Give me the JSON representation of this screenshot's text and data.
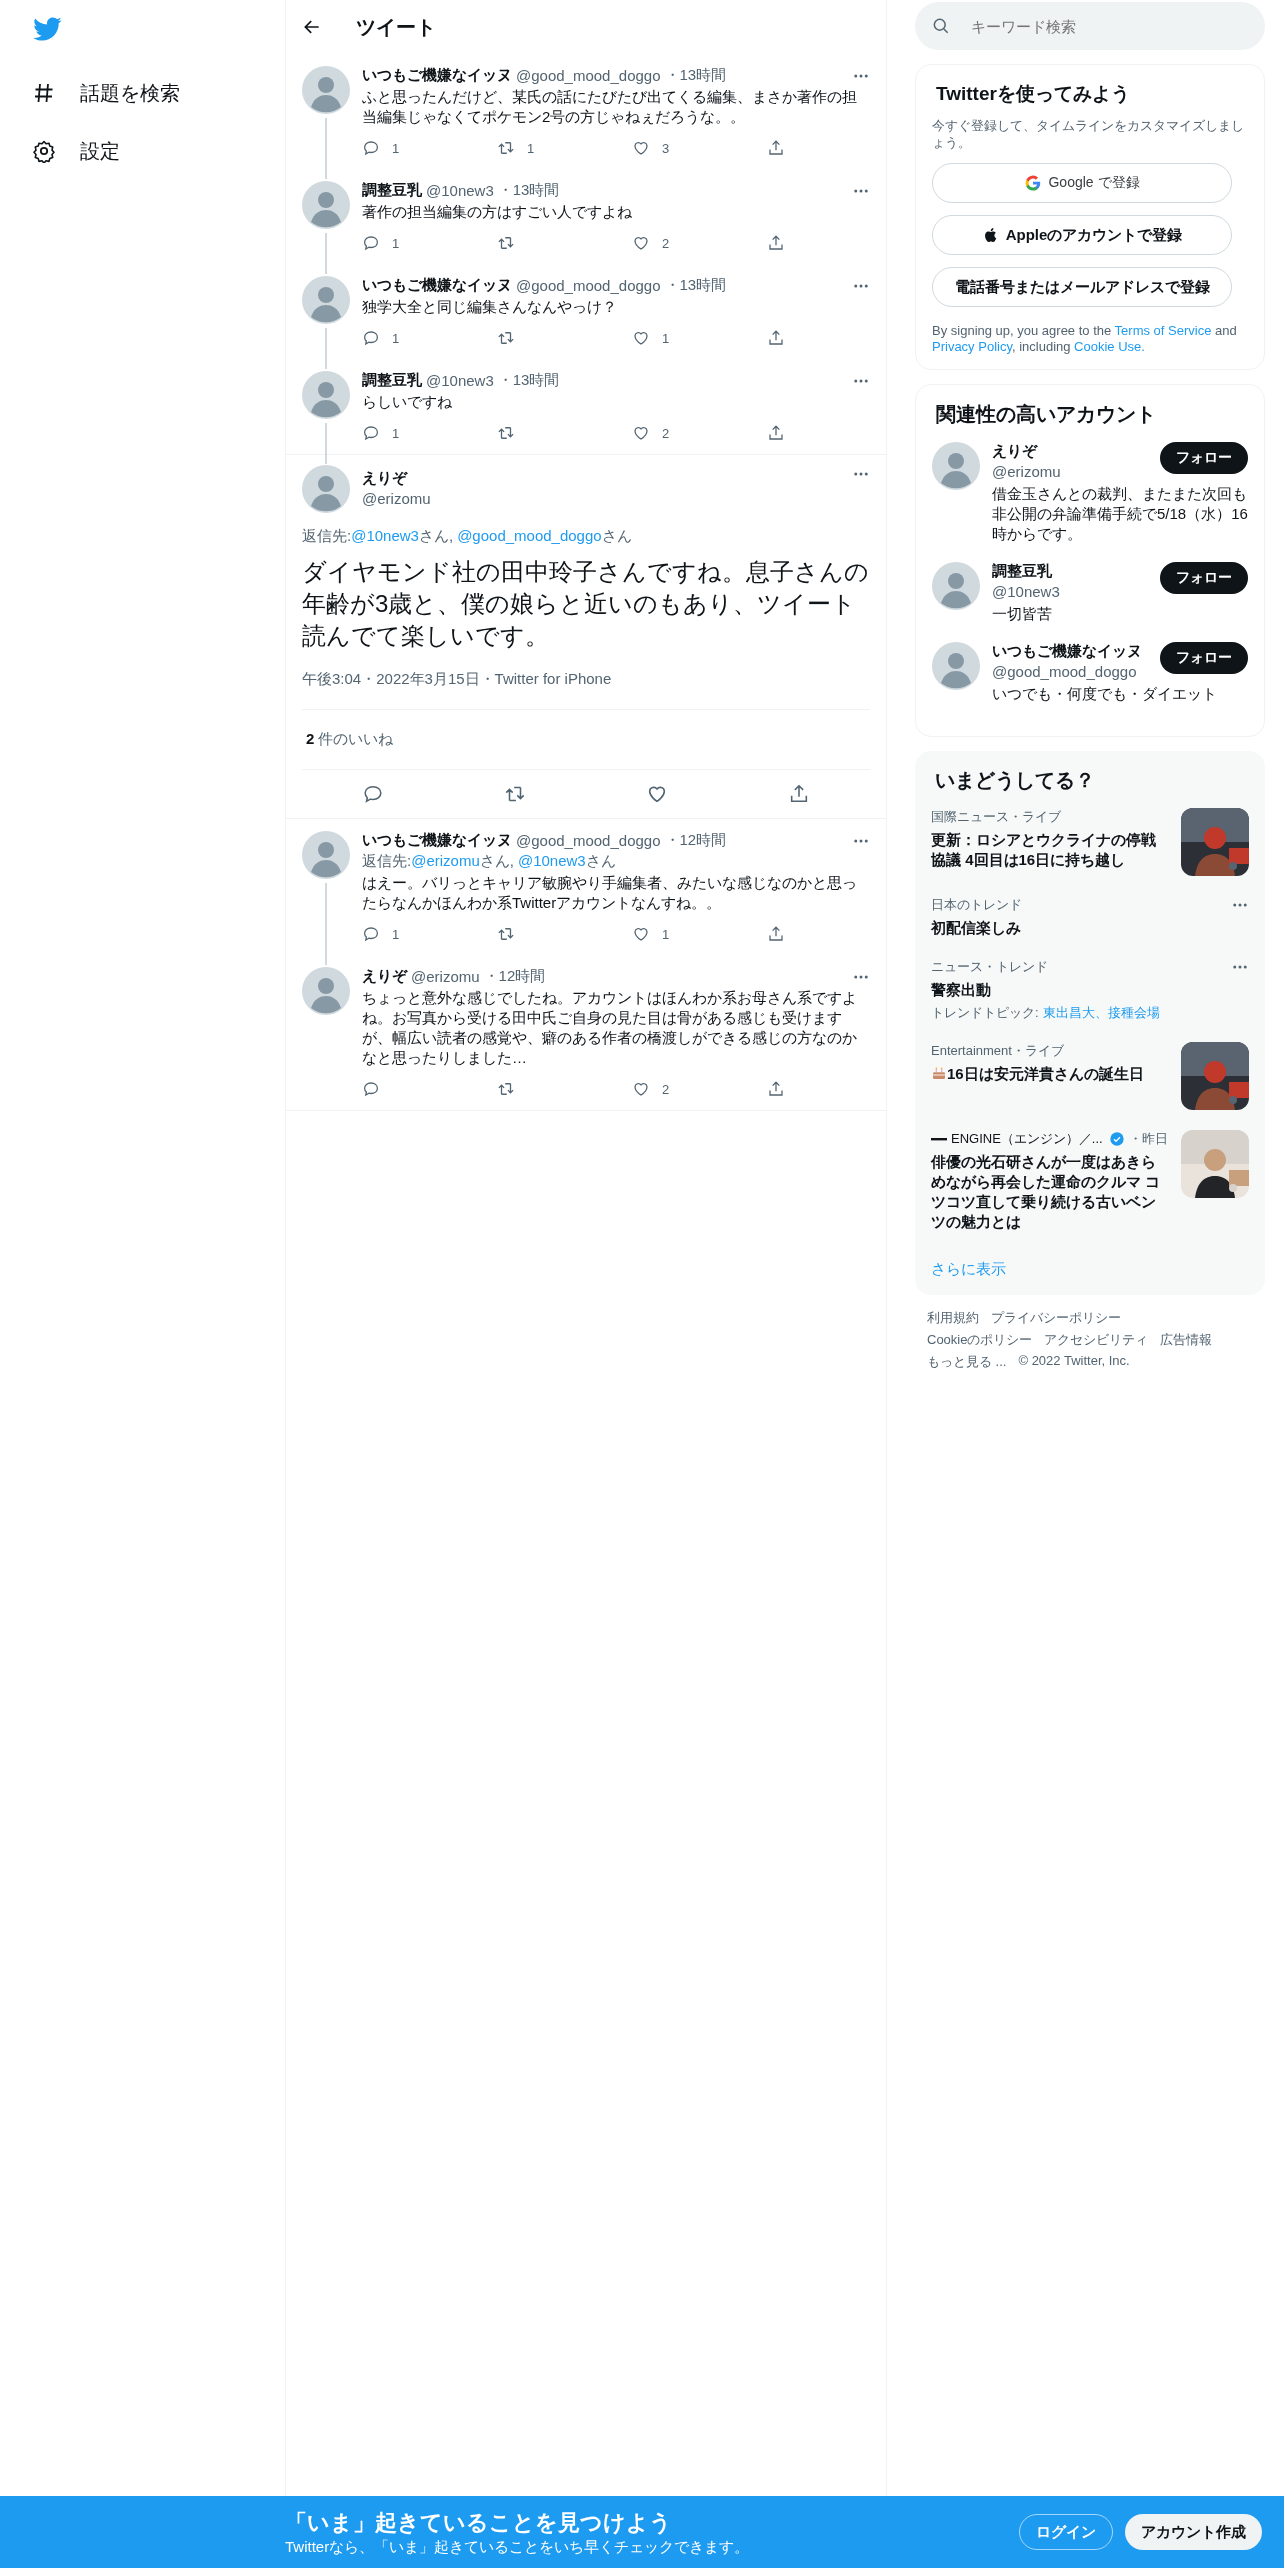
{
  "nav": {
    "items": [
      {
        "kind": "explore",
        "label": "話題を検索"
      },
      {
        "kind": "settings",
        "label": "設定"
      }
    ]
  },
  "header": {
    "title": "ツイート"
  },
  "thread": [
    {
      "name": "いつもご機嫌なイッヌ",
      "handle": "@good_mood_doggo",
      "time": "・13時間",
      "text": "ふと思ったんだけど、某氏の話にたびたび出てくる編集、まさか著作の担当編集じゃなくてポケモン2号の方じゃねぇだろうな。。",
      "connected": true,
      "replies": "1",
      "retweets": "1",
      "likes": "3"
    },
    {
      "name": "調整豆乳",
      "handle": "@10new3",
      "time": "・13時間",
      "text": "著作の担当編集の方はすごい人ですよね",
      "connected": true,
      "replies": "1",
      "likes": "2"
    },
    {
      "name": "いつもご機嫌なイッヌ",
      "handle": "@good_mood_doggo",
      "time": "・13時間",
      "text": "独学大全と同じ編集さんなんやっけ？",
      "connected": true,
      "replies": "1",
      "likes": "1"
    },
    {
      "name": "調整豆乳",
      "handle": "@10new3",
      "time": "・13時間",
      "text": "らしいですね",
      "connected": true,
      "replies": "1",
      "likes": "2"
    }
  ],
  "main": {
    "name": "えりぞ",
    "handle": "@erizomu",
    "reply_to": {
      "label": "返信先:",
      "mentions": [
        {
          "handle": "@10new3",
          "suffix": "さん,"
        },
        {
          "handle": "@good_mood_doggo",
          "suffix": "さん"
        }
      ]
    },
    "text": "ダイヤモンド社の田中玲子さんですね。息子さんの年齢が3歳と、僕の娘らと近いのもあり、ツイート読んでて楽しいです。",
    "meta": "午後3:04・2022年3月15日・Twitter for iPhone",
    "like_count": "2",
    "like_label": "件のいいね"
  },
  "replies": [
    {
      "name": "いつもご機嫌なイッヌ",
      "handle": "@good_mood_doggo",
      "time": "・12時間",
      "reply_to": {
        "label": "返信先:",
        "mentions": [
          {
            "handle": "@erizomu",
            "suffix": "さん,"
          },
          {
            "handle": "@10new3",
            "suffix": "さん"
          }
        ]
      },
      "text": "はえー。バリっとキャリア敏腕やり手編集者、みたいな感じなのかと思ったらなんかほんわか系Twitterアカウントなんすね。。",
      "connected": true,
      "replies": "1",
      "likes": "1"
    },
    {
      "name": "えりぞ",
      "handle": "@erizomu",
      "time": "・12時間",
      "text": "ちょっと意外な感じでしたね。アカウントはほんわか系お母さん系ですよね。お写真から受ける田中氏ご自身の見た目は骨がある感じも受けますが、幅広い読者の感覚や、癖のある作者の橋渡しができる感じの方なのかなと思ったりしました…",
      "connected": false,
      "likes": "2"
    }
  ],
  "search": {
    "placeholder": "キーワード検索"
  },
  "signup": {
    "title": "Twitterを使ってみよう",
    "subtitle": "今すぐ登録して、タイムラインをカスタマイズしましょう。",
    "buttons": [
      {
        "kind": "google",
        "label": "Google で登録"
      },
      {
        "kind": "apple",
        "label": "Appleのアカウントで登録"
      },
      {
        "kind": "plain",
        "label": "電話番号またはメールアドレスで登録"
      }
    ],
    "legal": [
      {
        "text": "By signing up, you agree to the ",
        "link": false
      },
      {
        "text": "Terms of Service",
        "link": true
      },
      {
        "text": " and ",
        "link": false
      },
      {
        "text": "Privacy Policy",
        "link": true
      },
      {
        "text": ", including ",
        "link": false
      },
      {
        "text": "Cookie Use.",
        "link": true
      }
    ]
  },
  "follow": {
    "title": "関連性の高いアカウント",
    "accounts": [
      {
        "name": "えりぞ",
        "handle": "@erizomu",
        "bio": "借金玉さんとの裁判、またまた次回も非公開の弁論準備手続で5/18（水）16時からです。",
        "button": "フォロー"
      },
      {
        "name": "調整豆乳",
        "handle": "@10new3",
        "bio": "一切皆苦",
        "button": "フォロー"
      },
      {
        "name": "いつもご機嫌なイッヌ",
        "handle": "@good_mood_doggo",
        "bio": "いつでも・何度でも・ダイエット",
        "button": "フォロー"
      }
    ]
  },
  "trends": {
    "title": "いまどうしてる？",
    "items": [
      {
        "kind": "news",
        "meta": "国際ニュース・ライブ",
        "title": "更新：ロシアとウクライナの停戦協議 4回目は16日に持ち越し",
        "picture": true,
        "menu": false
      },
      {
        "kind": "trend",
        "meta": "日本のトレンド",
        "title": "初配信楽しみ",
        "picture": false,
        "menu": true
      },
      {
        "kind": "trend",
        "meta": "ニュース・トレンド",
        "title": "警察出動",
        "topics_label": "トレンドトピック:",
        "topics": "東出昌大、接種会場",
        "picture": false,
        "menu": true
      },
      {
        "kind": "birthday",
        "meta": "Entertainment・ライブ",
        "title": "16日は安元洋貴さんの誕生日",
        "picture": true,
        "menu": false
      },
      {
        "kind": "source",
        "meta": "ENGINE（エンジン）／...",
        "verified": true,
        "time": "・昨日",
        "title": "俳優の光石研さんが一度はあきらめながら再会した運命のクルマ コツコツ直して乗り続ける古いベンツの魅力とは",
        "picture": true,
        "menu": false
      }
    ],
    "more": "さらに表示"
  },
  "footer": [
    [
      "利用規約",
      "プライバシーポリシー"
    ],
    [
      "Cookieのポリシー",
      "アクセシビリティ",
      "広告情報"
    ],
    [
      "もっと見る ...",
      "© 2022 Twitter, Inc."
    ]
  ],
  "banner": {
    "title": "「いま」起きていることを見つけよう",
    "subtitle": "Twitterなら、「いま」起きていることをいち早くチェックできます。",
    "login": "ログイン",
    "signup": "アカウント作成"
  }
}
